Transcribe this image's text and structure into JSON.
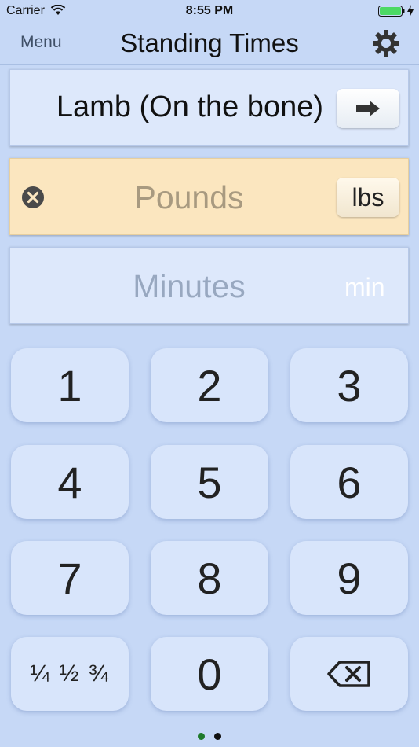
{
  "status_bar": {
    "carrier": "Carrier",
    "time": "8:55 PM"
  },
  "nav": {
    "menu_label": "Menu",
    "title": "Standing Times",
    "settings_icon": "gear-icon"
  },
  "item_panel": {
    "label": "Lamb (On the bone)",
    "next_icon": "right-arrow-icon"
  },
  "weight_panel": {
    "placeholder": "Pounds",
    "unit_label": "lbs",
    "clear_icon": "clear-circle-x-icon"
  },
  "time_panel": {
    "placeholder": "Minutes",
    "unit_label": "min"
  },
  "keypad": {
    "keys": [
      "1",
      "2",
      "3",
      "4",
      "5",
      "6",
      "7",
      "8",
      "9",
      "¼ ½ ¾",
      "0"
    ],
    "backspace_icon": "backspace-icon"
  },
  "page_indicator": {
    "pages": 2,
    "current": 1
  },
  "colors": {
    "background": "#c6d8f6",
    "weight_panel": "#fbe6bf",
    "current_page_dot": "#1f7a2c",
    "battery": "#4cd964"
  }
}
